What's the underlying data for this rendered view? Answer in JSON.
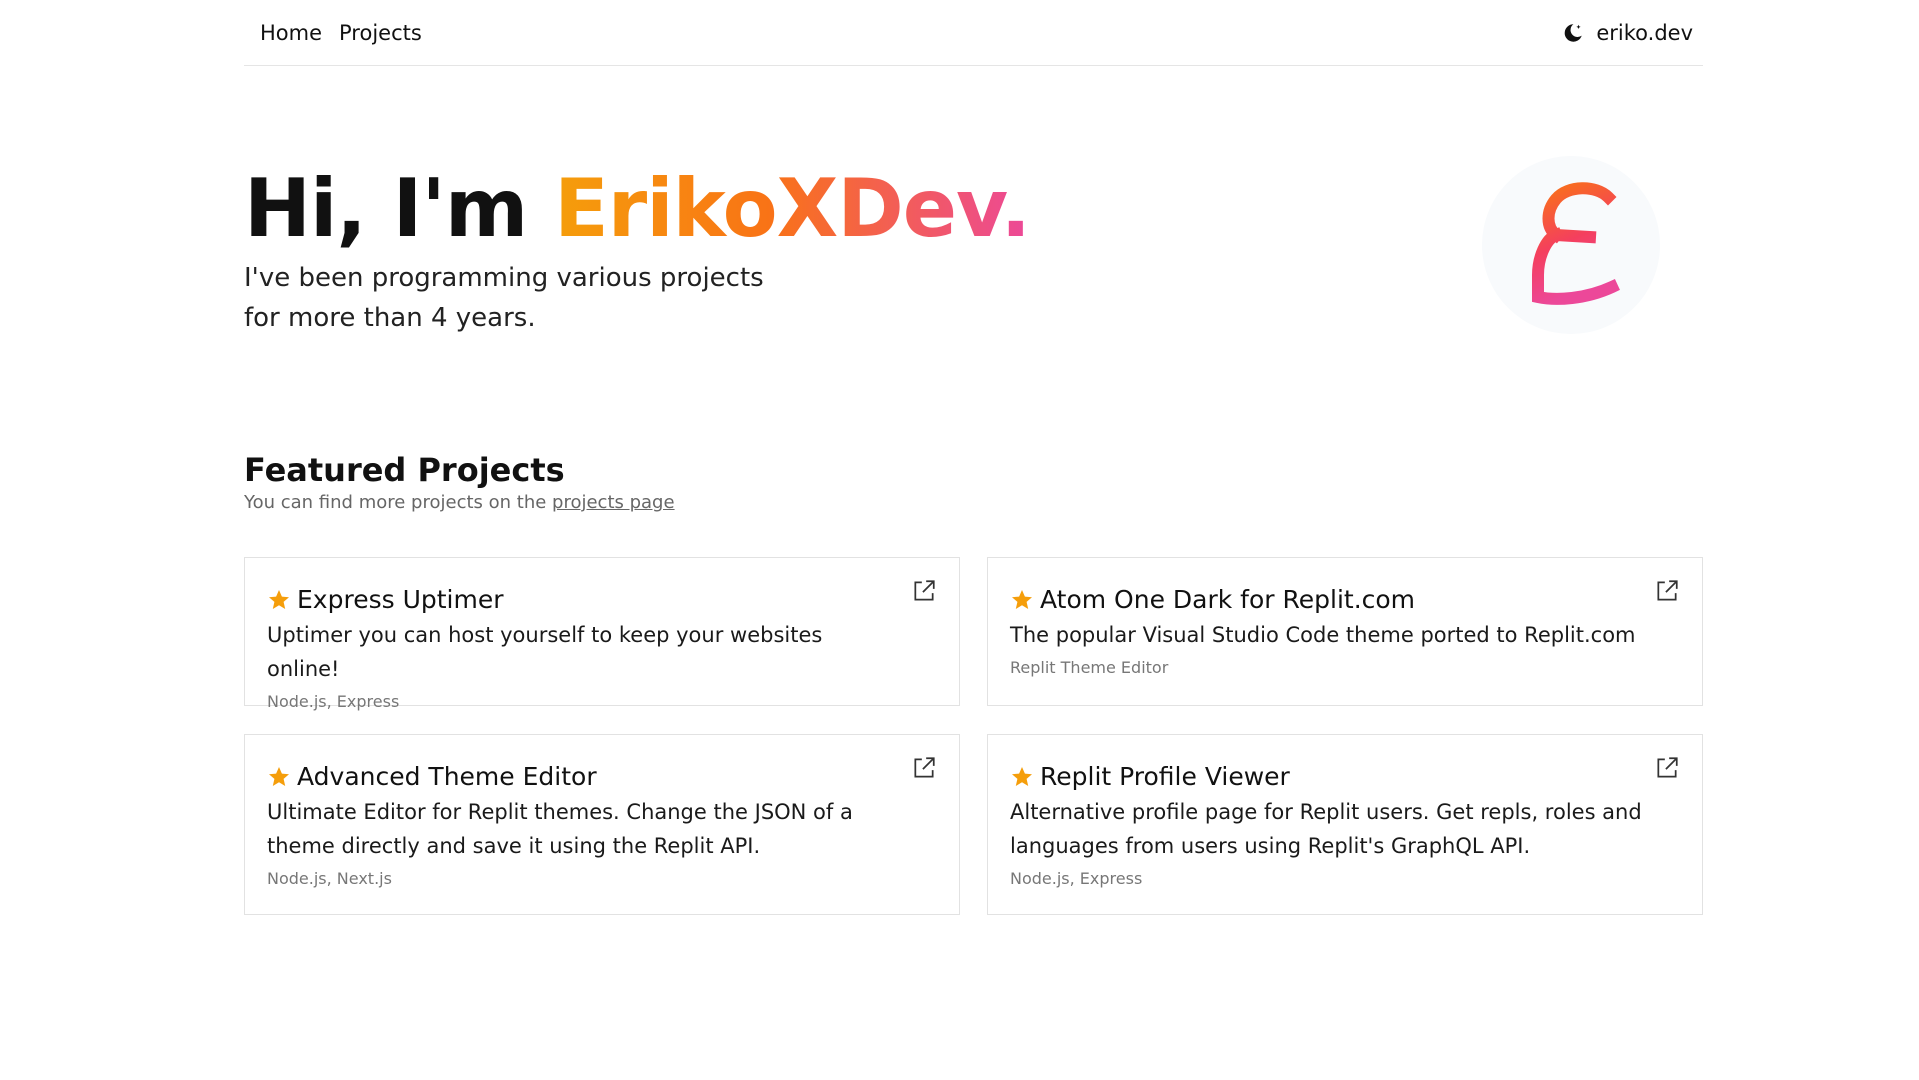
{
  "nav": {
    "links": [
      "Home",
      "Projects"
    ],
    "brand": "eriko.dev",
    "theme_icon": "moon-icon"
  },
  "hero": {
    "greeting": "Hi, I'm ",
    "name": "ErikoXDev.",
    "subtitle": "I've been programming various projects for more than 4 years.",
    "avatar_letter": "E"
  },
  "featured": {
    "title": "Featured Projects",
    "subtitle_prefix": "You can find more projects on the ",
    "link_text": "projects page"
  },
  "projects": [
    {
      "title": "Express Uptimer",
      "description": "Uptimer you can host yourself to keep your websites online!",
      "tags": "Node.js, Express"
    },
    {
      "title": "Atom One Dark for Replit.com",
      "description": "The popular Visual Studio Code theme ported to Replit.com",
      "tags": "Replit Theme Editor"
    },
    {
      "title": "Advanced Theme Editor",
      "description": "Ultimate Editor for Replit themes. Change the JSON of a theme directly and save it using the Replit API.",
      "tags": "Node.js, Next.js"
    },
    {
      "title": "Replit Profile Viewer",
      "description": "Alternative profile page for Replit users. Get repls, roles and languages from users using Replit's GraphQL API.",
      "tags": "Node.js, Express"
    }
  ],
  "colors": {
    "gradient_start": "#f59e0b",
    "gradient_mid": "#f97316",
    "gradient_end": "#ec4899",
    "star": "#f59e0b"
  }
}
